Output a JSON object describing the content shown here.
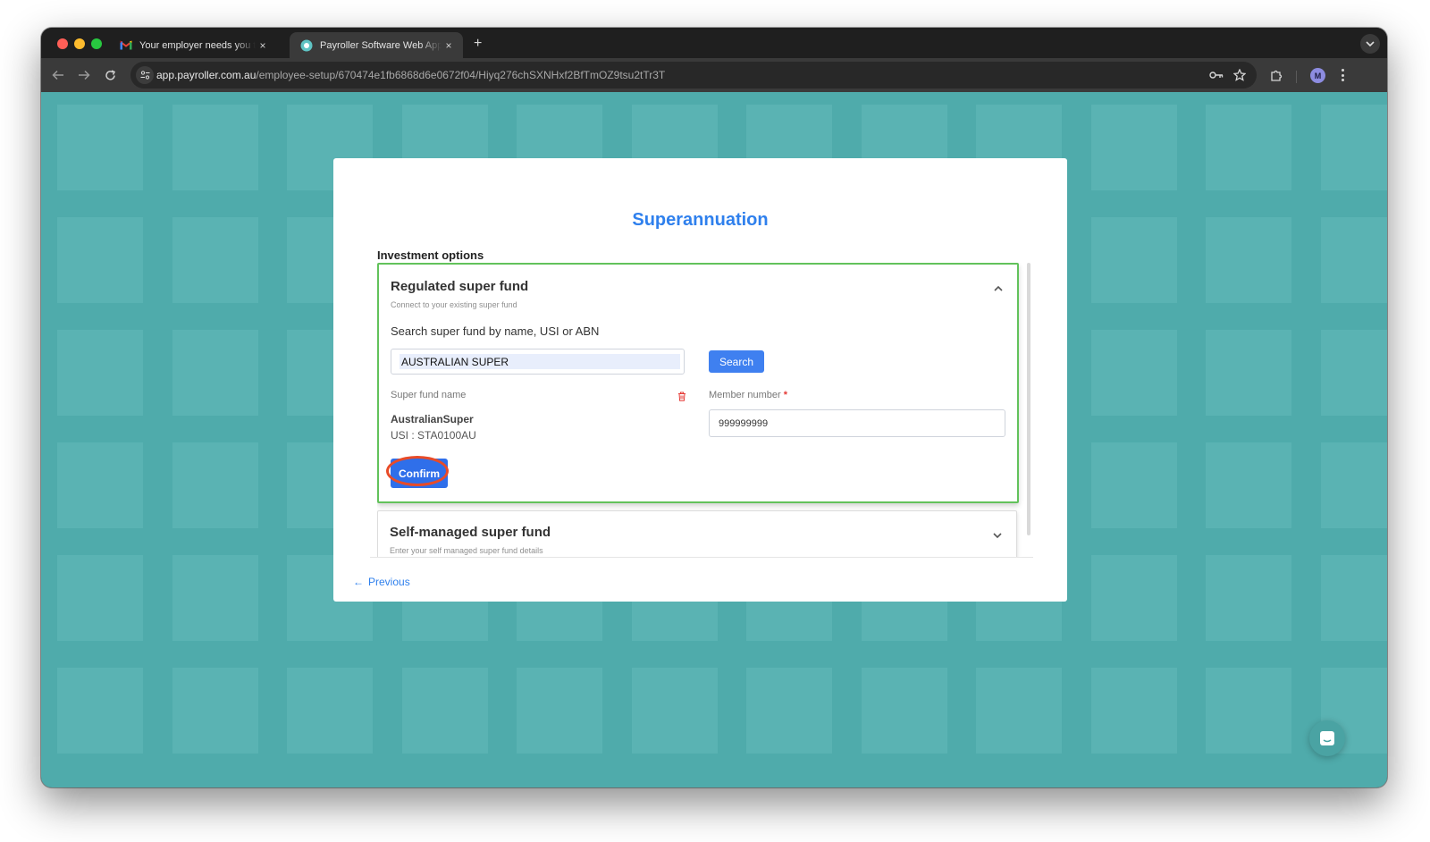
{
  "browser": {
    "tabs": [
      {
        "title": "Your employer needs you to fill",
        "favicon": "gmail-icon",
        "close": "×"
      },
      {
        "title": "Payroller Software Web Application",
        "favicon": "payroller-icon",
        "close": "×"
      }
    ],
    "new_tab": "+",
    "url_host": "app.payroller.com.au",
    "url_path": "/employee-setup/670474e1fb6868d6e0672f04/Hiyq276chSXNHxf2BfTmOZ9tsu2tTr3T",
    "profile_initial": "M"
  },
  "page": {
    "title": "Superannuation",
    "investment_options_label": "Investment options",
    "regulated": {
      "title": "Regulated super fund",
      "subtitle": "Connect to your existing super fund",
      "search_label": "Search super fund by name, USI or ABN",
      "search_value": "AUSTRALIAN SUPER",
      "search_button": "Search",
      "fund_name_label": "Super fund name",
      "fund_name": "AustralianSuper",
      "fund_usi": "USI : STA0100AU",
      "member_number_label": "Member number",
      "required_mark": "*",
      "member_number_value": "999999999",
      "confirm_button": "Confirm"
    },
    "self_managed": {
      "title": "Self-managed super fund",
      "subtitle": "Enter your self managed super fund details"
    },
    "previous_link": "Previous",
    "previous_arrow": "←"
  },
  "colors": {
    "accent": "#2f80ed",
    "background": "#4fabab",
    "panel_border_active": "#62c25b",
    "highlight_ring": "#e84b28"
  }
}
